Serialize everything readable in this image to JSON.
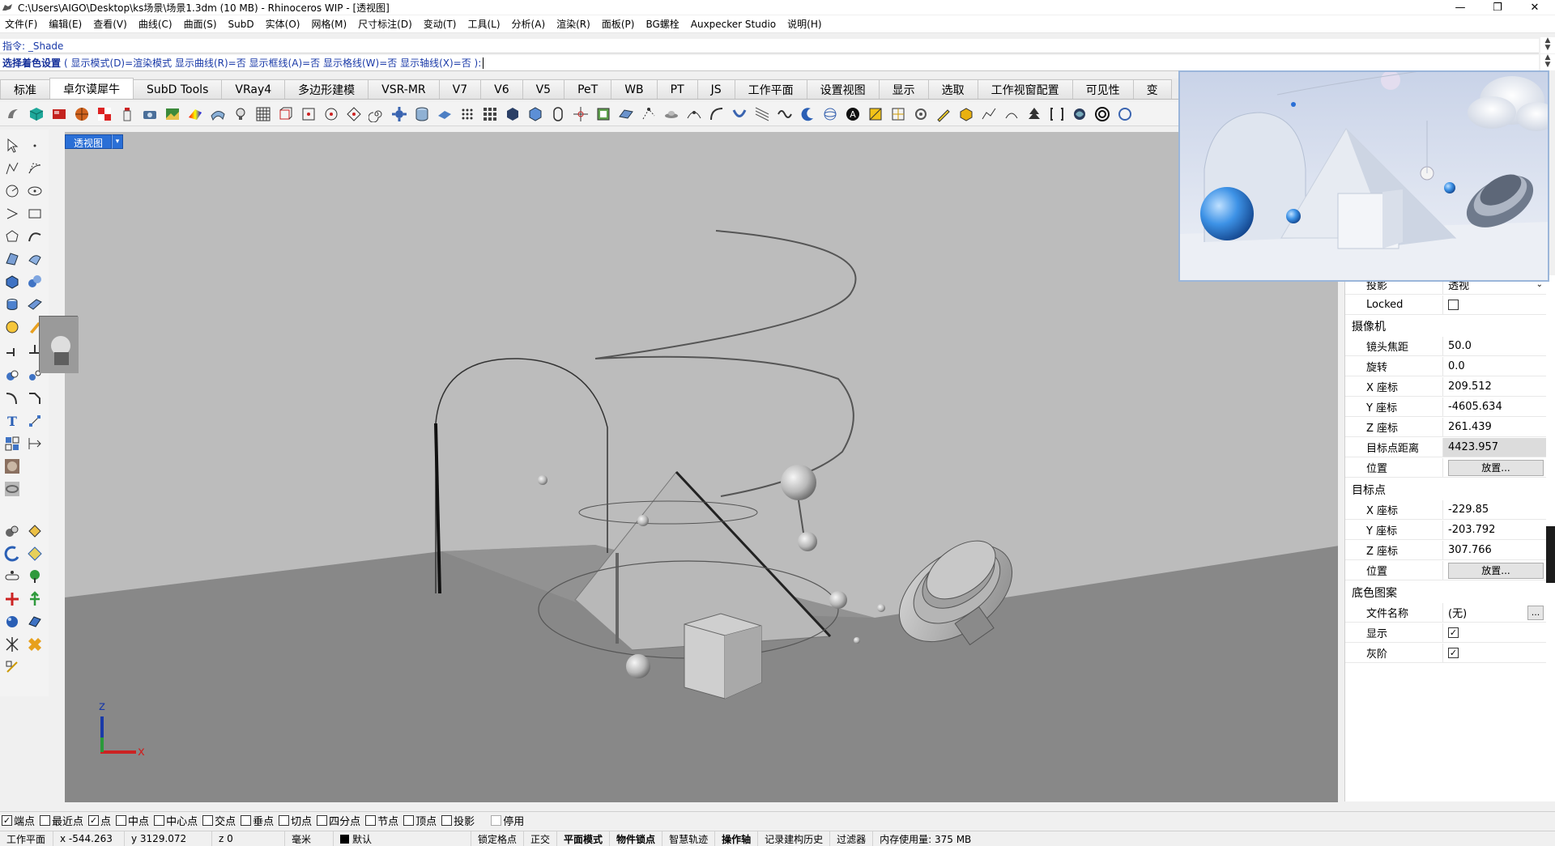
{
  "window": {
    "title": "C:\\Users\\AIGO\\Desktop\\ks场景\\场景1.3dm (10 MB) - Rhinoceros WIP - [透视图]",
    "minimize": "—",
    "maximize": "❐",
    "close": "✕"
  },
  "menu": [
    "文件(F)",
    "编辑(E)",
    "查看(V)",
    "曲线(C)",
    "曲面(S)",
    "SubD",
    "实体(O)",
    "网格(M)",
    "尺寸标注(D)",
    "变动(T)",
    "工具(L)",
    "分析(A)",
    "渲染(R)",
    "面板(P)",
    "BG螺栓",
    "Auxpecker Studio",
    "说明(H)"
  ],
  "command": {
    "history": "指令: _Shade",
    "prompt": "选择着色设置",
    "options": "( 显示模式(D)=渲染模式  显示曲线(R)=否  显示框线(A)=否  显示格线(W)=否  显示轴线(X)=否 ):"
  },
  "tabs": [
    "标准",
    "卓尔谟犀牛",
    "SubD Tools",
    "VRay4",
    "多边形建模",
    "VSR-MR",
    "V7",
    "V6",
    "V5",
    "PeT",
    "WB",
    "PT",
    "JS",
    "工作平面",
    "设置视图",
    "显示",
    "选取",
    "工作视窗配置",
    "可见性",
    "变"
  ],
  "active_tab": "卓尔谟犀牛",
  "viewport": {
    "label": "透视图",
    "dropdown": "▾",
    "axis_x": "x",
    "axis_z": "z"
  },
  "properties": {
    "projection_label": "投影",
    "projection_value": "透视",
    "locked_label": "Locked",
    "camera_section": "摄像机",
    "camera": [
      {
        "label": "镜头焦距",
        "value": "50.0"
      },
      {
        "label": "旋转",
        "value": "0.0"
      },
      {
        "label": "X 座标",
        "value": "209.512"
      },
      {
        "label": "Y 座标",
        "value": "-4605.634"
      },
      {
        "label": "Z 座标",
        "value": "261.439"
      },
      {
        "label": "目标点距离",
        "value": "4423.957"
      }
    ],
    "position_label": "位置",
    "place_button": "放置...",
    "target_section": "目标点",
    "target": [
      {
        "label": "X 座标",
        "value": "-229.85"
      },
      {
        "label": "Y 座标",
        "value": "-203.792"
      },
      {
        "label": "Z 座标",
        "value": "307.766"
      }
    ],
    "background_section": "底色图案",
    "filename_label": "文件名称",
    "filename_value": "(无)",
    "browse_button": "...",
    "show_label": "显示",
    "grayscale_label": "灰阶"
  },
  "osnaps": [
    {
      "label": "端点",
      "checked": true
    },
    {
      "label": "最近点",
      "checked": false
    },
    {
      "label": "点",
      "checked": true
    },
    {
      "label": "中点",
      "checked": false
    },
    {
      "label": "中心点",
      "checked": false
    },
    {
      "label": "交点",
      "checked": false
    },
    {
      "label": "垂点",
      "checked": false
    },
    {
      "label": "切点",
      "checked": false
    },
    {
      "label": "四分点",
      "checked": false
    },
    {
      "label": "节点",
      "checked": false
    },
    {
      "label": "顶点",
      "checked": false
    },
    {
      "label": "投影",
      "checked": false
    },
    {
      "label": "停用",
      "checked": false
    }
  ],
  "status": {
    "cplane": "工作平面",
    "x": "x -544.263",
    "y": "y 3129.072",
    "z": "z 0",
    "units": "毫米",
    "layer": "默认",
    "grid_snap": "锁定格点",
    "ortho": "正交",
    "planar": "平面模式",
    "osnap": "物件锁点",
    "smarttrack": "智慧轨迹",
    "gumball": "操作轴",
    "history": "记录建构历史",
    "filter": "过滤器",
    "memory": "内存使用量: 375 MB"
  }
}
